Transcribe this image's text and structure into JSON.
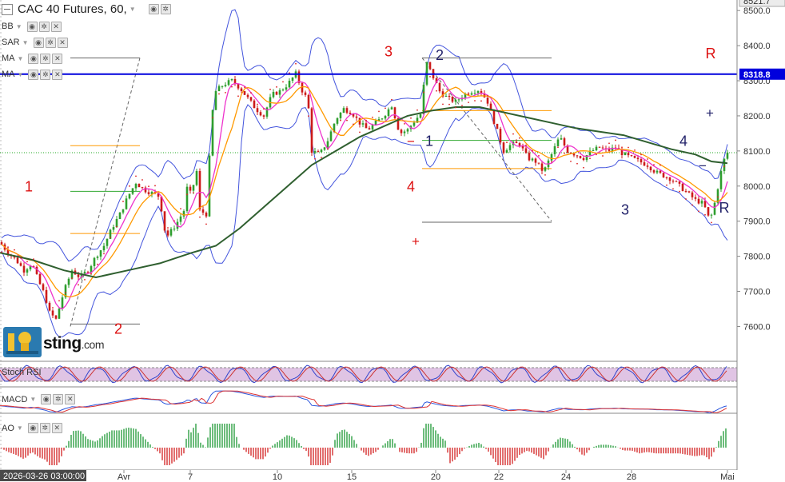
{
  "header": {
    "title": "CAC 40 Futures, 60,"
  },
  "indicators": [
    {
      "label": "BB"
    },
    {
      "label": "SAR"
    },
    {
      "label": "MA"
    },
    {
      "label": "MA"
    }
  ],
  "panes": {
    "stoch": {
      "label": "Stoch RSI"
    },
    "macd": {
      "label": "MACD"
    },
    "ao": {
      "label": "AO"
    }
  },
  "logo": {
    "text": "sting",
    "suffix": ".com"
  },
  "colors": {
    "price_line": "#0000dd",
    "up": "#2e9e2e",
    "down": "#cc1a1a",
    "bb": "#4455dd",
    "ma_long": "#2f5f2f",
    "ma_fast": "#ff9900",
    "ma_pink": "#ee33cc",
    "sar": "#dd2222",
    "red_label": "#dd1111",
    "navy_label": "#22226a"
  },
  "chart_data": {
    "type": "candlestick",
    "title": "CAC 40 Futures, 60,",
    "ylim": [
      7510,
      8530
    ],
    "y_ticks": [
      "8500.0",
      "8400.0",
      "8300.0",
      "8200.0",
      "8100.0",
      "8000.0",
      "7900.0",
      "7800.0",
      "7700.0",
      "7600.0"
    ],
    "price_top_label": "8521.7",
    "current_price_label": "8318.8",
    "current_price": 8318.8,
    "last_close": 8095,
    "x_labels": [
      "2026-03-26 03:00:00",
      "Avr",
      "7",
      "10",
      "15",
      "20",
      "22",
      "24",
      "28",
      "Mai"
    ],
    "close_path": [
      [
        0,
        7840
      ],
      [
        10,
        7810
      ],
      [
        20,
        7790
      ],
      [
        30,
        7760
      ],
      [
        40,
        7780
      ],
      [
        48,
        7730
      ],
      [
        56,
        7690
      ],
      [
        62,
        7640
      ],
      [
        70,
        7620
      ],
      [
        80,
        7700
      ],
      [
        90,
        7760
      ],
      [
        100,
        7740
      ],
      [
        110,
        7760
      ],
      [
        120,
        7800
      ],
      [
        130,
        7830
      ],
      [
        140,
        7880
      ],
      [
        150,
        7920
      ],
      [
        160,
        7970
      ],
      [
        170,
        8010
      ],
      [
        180,
        7990
      ],
      [
        190,
        7980
      ],
      [
        200,
        7970
      ],
      [
        205,
        7880
      ],
      [
        210,
        7860
      ],
      [
        220,
        7890
      ],
      [
        230,
        7930
      ],
      [
        235,
        8010
      ],
      [
        240,
        7960
      ],
      [
        245,
        8070
      ],
      [
        250,
        7930
      ],
      [
        258,
        7920
      ],
      [
        265,
        8200
      ],
      [
        270,
        8270
      ],
      [
        280,
        8290
      ],
      [
        290,
        8300
      ],
      [
        300,
        8280
      ],
      [
        310,
        8250
      ],
      [
        320,
        8220
      ],
      [
        330,
        8200
      ],
      [
        340,
        8260
      ],
      [
        350,
        8270
      ],
      [
        360,
        8290
      ],
      [
        370,
        8320
      ],
      [
        380,
        8260
      ],
      [
        385,
        8250
      ],
      [
        390,
        8100
      ],
      [
        400,
        8090
      ],
      [
        410,
        8130
      ],
      [
        420,
        8190
      ],
      [
        430,
        8220
      ],
      [
        440,
        8210
      ],
      [
        450,
        8180
      ],
      [
        460,
        8160
      ],
      [
        470,
        8180
      ],
      [
        480,
        8200
      ],
      [
        490,
        8230
      ],
      [
        500,
        8150
      ],
      [
        510,
        8160
      ],
      [
        520,
        8190
      ],
      [
        528,
        8210
      ],
      [
        532,
        8360
      ],
      [
        540,
        8320
      ],
      [
        550,
        8270
      ],
      [
        560,
        8250
      ],
      [
        570,
        8240
      ],
      [
        580,
        8260
      ],
      [
        590,
        8270
      ],
      [
        600,
        8275
      ],
      [
        610,
        8240
      ],
      [
        620,
        8170
      ],
      [
        630,
        8100
      ],
      [
        640,
        8120
      ],
      [
        650,
        8120
      ],
      [
        660,
        8080
      ],
      [
        670,
        8070
      ],
      [
        680,
        8040
      ],
      [
        690,
        8090
      ],
      [
        700,
        8140
      ],
      [
        710,
        8100
      ],
      [
        720,
        8090
      ],
      [
        730,
        8080
      ],
      [
        740,
        8100
      ],
      [
        750,
        8110
      ],
      [
        760,
        8100
      ],
      [
        770,
        8110
      ],
      [
        780,
        8090
      ],
      [
        790,
        8080
      ],
      [
        800,
        8070
      ],
      [
        810,
        8060
      ],
      [
        820,
        8040
      ],
      [
        830,
        8030
      ],
      [
        840,
        8020
      ],
      [
        850,
        8000
      ],
      [
        860,
        7980
      ],
      [
        870,
        7960
      ],
      [
        880,
        7950
      ],
      [
        888,
        7900
      ],
      [
        895,
        7960
      ],
      [
        900,
        8020
      ],
      [
        905,
        8070
      ],
      [
        910,
        8095
      ]
    ],
    "ma_long_path": [
      [
        0,
        7810
      ],
      [
        40,
        7790
      ],
      [
        80,
        7760
      ],
      [
        120,
        7740
      ],
      [
        160,
        7760
      ],
      [
        200,
        7780
      ],
      [
        240,
        7810
      ],
      [
        270,
        7830
      ],
      [
        300,
        7880
      ],
      [
        330,
        7940
      ],
      [
        360,
        8000
      ],
      [
        390,
        8060
      ],
      [
        420,
        8100
      ],
      [
        450,
        8140
      ],
      [
        480,
        8170
      ],
      [
        510,
        8200
      ],
      [
        540,
        8215
      ],
      [
        570,
        8225
      ],
      [
        600,
        8225
      ],
      [
        630,
        8210
      ],
      [
        660,
        8195
      ],
      [
        690,
        8180
      ],
      [
        720,
        8165
      ],
      [
        750,
        8155
      ],
      [
        780,
        8145
      ],
      [
        810,
        8125
      ],
      [
        840,
        8105
      ],
      [
        870,
        8090
      ],
      [
        890,
        8070
      ],
      [
        910,
        8065
      ]
    ],
    "annotations": [
      {
        "text": "1",
        "x": 36,
        "y": 7995,
        "color": "red"
      },
      {
        "text": "2",
        "x": 148,
        "y": 7590,
        "color": "red"
      },
      {
        "text": "3",
        "x": 486,
        "y": 8380,
        "color": "red"
      },
      {
        "text": "4",
        "x": 514,
        "y": 7995,
        "color": "red"
      },
      {
        "text": "R",
        "x": 889,
        "y": 8375,
        "color": "red"
      },
      {
        "text": "+",
        "x": 520,
        "y": 7840,
        "color": "red"
      },
      {
        "text": "−",
        "x": 514,
        "y": 8125,
        "color": "red"
      },
      {
        "text": "1",
        "x": 537,
        "y": 8125,
        "color": "navy"
      },
      {
        "text": "2",
        "x": 550,
        "y": 8370,
        "color": "navy"
      },
      {
        "text": "3",
        "x": 782,
        "y": 7930,
        "color": "navy"
      },
      {
        "text": "4",
        "x": 855,
        "y": 8125,
        "color": "navy"
      },
      {
        "text": "R",
        "x": 906,
        "y": 7935,
        "color": "navy"
      },
      {
        "text": "+",
        "x": 888,
        "y": 8205,
        "color": "navy"
      },
      {
        "text": "−",
        "x": 879,
        "y": 8055,
        "color": "navy"
      }
    ]
  }
}
